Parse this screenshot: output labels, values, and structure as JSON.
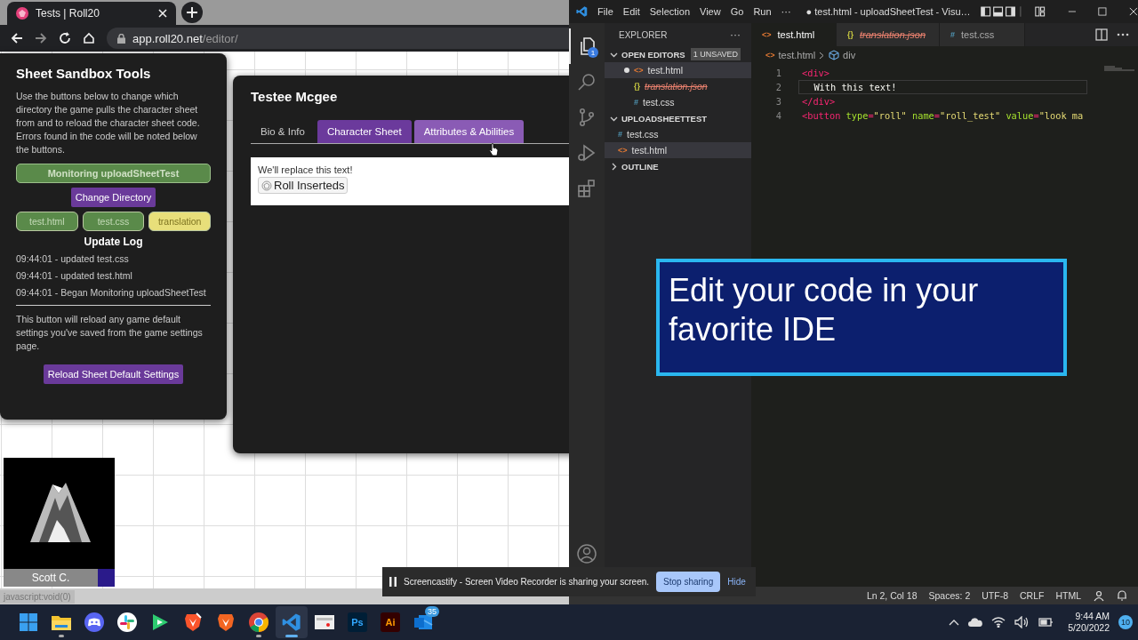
{
  "browser": {
    "tab_title": "Tests | Roll20",
    "url_host": "app.roll20.net",
    "url_path": "/editor/",
    "status_link": "javascript:void(0)"
  },
  "sandbox": {
    "title": "Sheet Sandbox Tools",
    "intro": "Use the buttons below to change which directory the game pulls the character sheet from and to reload the character sheet code. Errors found in the code will be noted below the buttons.",
    "monitor_button": "Monitoring uploadSheetTest",
    "change_button": "Change Directory",
    "files": [
      {
        "label": "test.html",
        "color": "#5a8a4a"
      },
      {
        "label": "test.css",
        "color": "#5a8a4a"
      },
      {
        "label": "translation",
        "color": "#e8df7a"
      }
    ],
    "log_title": "Update Log",
    "log": [
      "09:44:01 - updated test.css",
      "09:44:01 - updated test.html",
      "09:44:01 - Began Monitoring uploadSheetTest"
    ],
    "reload_note": "This button will reload any game default settings you've saved from the game settings page.",
    "reload_button": "Reload Sheet Default Settings"
  },
  "sheet": {
    "title": "Testee Mcgee",
    "tabs": [
      {
        "label": "Bio & Info",
        "selected": false,
        "hovered": false
      },
      {
        "label": "Character Sheet",
        "selected": true,
        "hovered": false
      },
      {
        "label": "Attributes & Abilities",
        "selected": false,
        "hovered": true
      }
    ],
    "content_text": "We'll replace this text!",
    "roll_button": "Roll Inserteds"
  },
  "video": {
    "name": "Scott C."
  },
  "screen_share": {
    "message": "Screencastify - Screen Video Recorder is sharing your screen.",
    "stop": "Stop sharing",
    "hide": "Hide"
  },
  "vscode": {
    "menu": [
      "File",
      "Edit",
      "Selection",
      "View",
      "Go",
      "Run",
      "···"
    ],
    "title": "● test.html - uploadSheetTest - Visu…",
    "activity": [
      {
        "kind": "files",
        "selected": true,
        "badge": "1"
      },
      {
        "kind": "search",
        "selected": false
      },
      {
        "kind": "source-control",
        "selected": false
      },
      {
        "kind": "run",
        "selected": false
      },
      {
        "kind": "extensions",
        "selected": false
      }
    ],
    "explorer_title": "EXPLORER",
    "explorer_more": "···",
    "sections": [
      {
        "title": "OPEN EDITORS",
        "badge": "1 UNSAVED",
        "expanded": true,
        "items": [
          {
            "label": "test.html",
            "kind": "html",
            "icon": "<>",
            "dirty": true,
            "deleted": false,
            "selected": true
          },
          {
            "label": "translation.json",
            "kind": "json",
            "icon": "{}",
            "dirty": false,
            "deleted": true,
            "selected": false
          },
          {
            "label": "test.css",
            "kind": "css",
            "icon": "#",
            "dirty": false,
            "deleted": false,
            "selected": false
          }
        ]
      },
      {
        "title": "UPLOADSHEETTEST",
        "expanded": true,
        "items": [
          {
            "label": "test.css",
            "kind": "css",
            "icon": "#",
            "dirty": false,
            "deleted": false,
            "selected": false
          },
          {
            "label": "test.html",
            "kind": "html",
            "icon": "<>",
            "dirty": false,
            "deleted": false,
            "selected": true
          }
        ]
      },
      {
        "title": "OUTLINE",
        "expanded": false
      }
    ],
    "tabs": [
      {
        "label": "test.html",
        "kind": "html",
        "icon": "<>",
        "selected": true,
        "dirty": true,
        "deleted": false
      },
      {
        "label": "translation.json",
        "kind": "json",
        "icon": "{}",
        "selected": false,
        "dirty": false,
        "deleted": true
      },
      {
        "label": "test.css",
        "kind": "css",
        "icon": "#",
        "selected": false,
        "dirty": false,
        "deleted": false
      }
    ],
    "breadcrumbs": [
      {
        "kind": "file",
        "icon": "<>",
        "label": "test.html"
      },
      {
        "kind": "element",
        "label": "div"
      }
    ],
    "lines": [
      {
        "number": "1",
        "current": false,
        "tokens": [
          {
            "kind": "punct",
            "text": "<"
          },
          {
            "kind": "tag",
            "text": "div"
          },
          {
            "kind": "punct",
            "text": ">"
          }
        ]
      },
      {
        "number": "2",
        "current": true,
        "tokens": [
          {
            "kind": "text",
            "text": "  With this text!"
          }
        ]
      },
      {
        "number": "3",
        "current": false,
        "tokens": [
          {
            "kind": "punct",
            "text": "</"
          },
          {
            "kind": "tag",
            "text": "div"
          },
          {
            "kind": "punct",
            "text": ">"
          }
        ]
      },
      {
        "number": "4",
        "current": false,
        "tokens": [
          {
            "kind": "punct",
            "text": "<"
          },
          {
            "kind": "tag",
            "text": "button"
          },
          {
            "kind": "attr",
            "text": " type"
          },
          {
            "kind": "punct",
            "text": "="
          },
          {
            "kind": "string",
            "text": "\"roll\""
          },
          {
            "kind": "attr",
            "text": " name"
          },
          {
            "kind": "punct",
            "text": "="
          },
          {
            "kind": "string",
            "text": "\"roll_test\""
          },
          {
            "kind": "attr",
            "text": " value"
          },
          {
            "kind": "punct",
            "text": "="
          },
          {
            "kind": "string",
            "text": "\"look ma"
          }
        ]
      }
    ],
    "caption": "Edit your code in your favorite IDE",
    "status": [
      "Ln 2, Col 18",
      "Spaces: 2",
      "UTF-8",
      "CRLF",
      "HTML"
    ]
  },
  "taskbar": {
    "apps": [
      {
        "kind": "start",
        "running": false,
        "selected": false
      },
      {
        "kind": "folder",
        "running": true,
        "selected": false
      },
      {
        "kind": "chat",
        "running": false,
        "selected": false
      },
      {
        "kind": "pinwheel",
        "running": false,
        "selected": false
      },
      {
        "kind": "play",
        "running": false,
        "selected": false
      },
      {
        "kind": "shield-pen",
        "running": false,
        "selected": false
      },
      {
        "kind": "shield",
        "running": false,
        "selected": false
      },
      {
        "kind": "chrome",
        "running": true,
        "selected": false
      },
      {
        "kind": "code",
        "running": true,
        "selected": true
      },
      {
        "kind": "recorder",
        "running": false,
        "selected": false
      },
      {
        "kind": "ps",
        "label": "Ps",
        "running": false,
        "selected": false
      },
      {
        "kind": "ai",
        "label": "Ai",
        "running": false,
        "selected": false
      },
      {
        "kind": "mail",
        "badge": "35",
        "running": false,
        "selected": false
      }
    ],
    "time": "9:44 AM",
    "date": "5/20/2022",
    "notifications": "10"
  }
}
